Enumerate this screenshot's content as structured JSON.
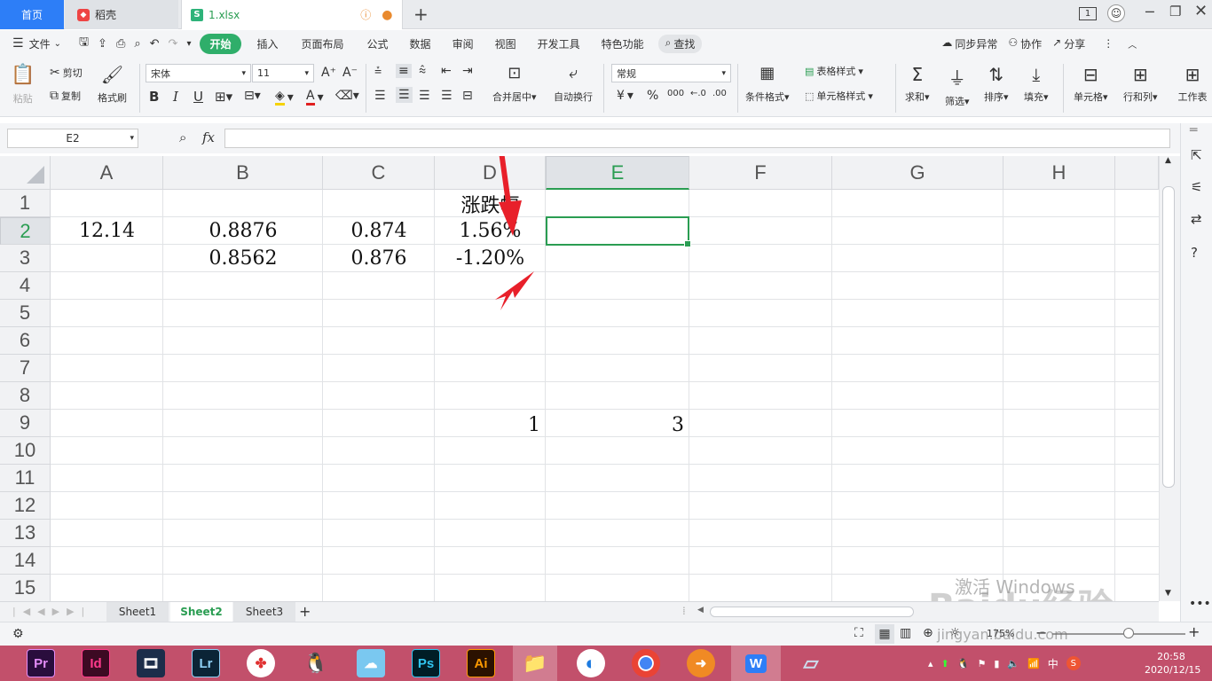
{
  "tabs": {
    "home": "首页",
    "daoke": "稻壳",
    "file": "1.xlsx",
    "add": "+",
    "page_indicator": "1"
  },
  "menu": {
    "file": "文件",
    "items": [
      "开始",
      "插入",
      "页面布局",
      "公式",
      "数据",
      "审阅",
      "视图",
      "开发工具",
      "特色功能"
    ],
    "search": "查找",
    "sync": "同步异常",
    "collab": "协作",
    "share": "分享"
  },
  "ribbon": {
    "paste": "粘贴",
    "cut": "剪切",
    "copy": "复制",
    "format_painter": "格式刷",
    "font_name": "宋体",
    "font_size": "11",
    "bold": "B",
    "italic": "I",
    "underline": "U",
    "merge_center": "合并居中",
    "wrap_text": "自动换行",
    "number_format": "常规",
    "currency": "¥",
    "percent": "%",
    "thousands": "000",
    "cond_format": "条件格式",
    "table_style": "表格样式",
    "cell_style": "单元格样式",
    "sum": "求和",
    "filter": "筛选",
    "sort": "排序",
    "fill": "填充",
    "cell": "单元格",
    "row_col": "行和列",
    "worksheet": "工作表"
  },
  "formula_bar": {
    "name_box": "E2",
    "fx": "fx",
    "value": ""
  },
  "sheet": {
    "columns": [
      "A",
      "B",
      "C",
      "D",
      "E",
      "F",
      "G",
      "H"
    ],
    "selected_column": "E",
    "rows": [
      "1",
      "2",
      "3",
      "4",
      "5",
      "6",
      "7",
      "8",
      "9",
      "10",
      "11",
      "12",
      "13",
      "14",
      "15"
    ],
    "selected_row": "2",
    "cells": {
      "D1": "涨跌幅",
      "A2": "12.14",
      "B2": "0.8876",
      "C2": "0.874",
      "D2": "1.56%",
      "B3": "0.8562",
      "C3": "0.876",
      "D3": "-1.20%",
      "D9": "1",
      "E9": "3"
    }
  },
  "sheet_tabs": [
    "Sheet1",
    "Sheet2",
    "Sheet3"
  ],
  "active_sheet": "Sheet2",
  "status": {
    "zoom": "175%"
  },
  "watermark": {
    "activate": "激活 Windows",
    "site": "jingyan.baidu.com",
    "brand": "Baidu经验"
  },
  "taskbar": {
    "apps": [
      "Pr",
      "Id",
      "Lr",
      "Ps",
      "Ai"
    ],
    "input_method": "中",
    "time": "20:58",
    "date": "2020/12/15"
  },
  "colors": {
    "wps_green": "#2a9d52",
    "arrow_red": "#e8202a",
    "taskbar": "#c2506b",
    "home_tab": "#2d7ef7"
  }
}
